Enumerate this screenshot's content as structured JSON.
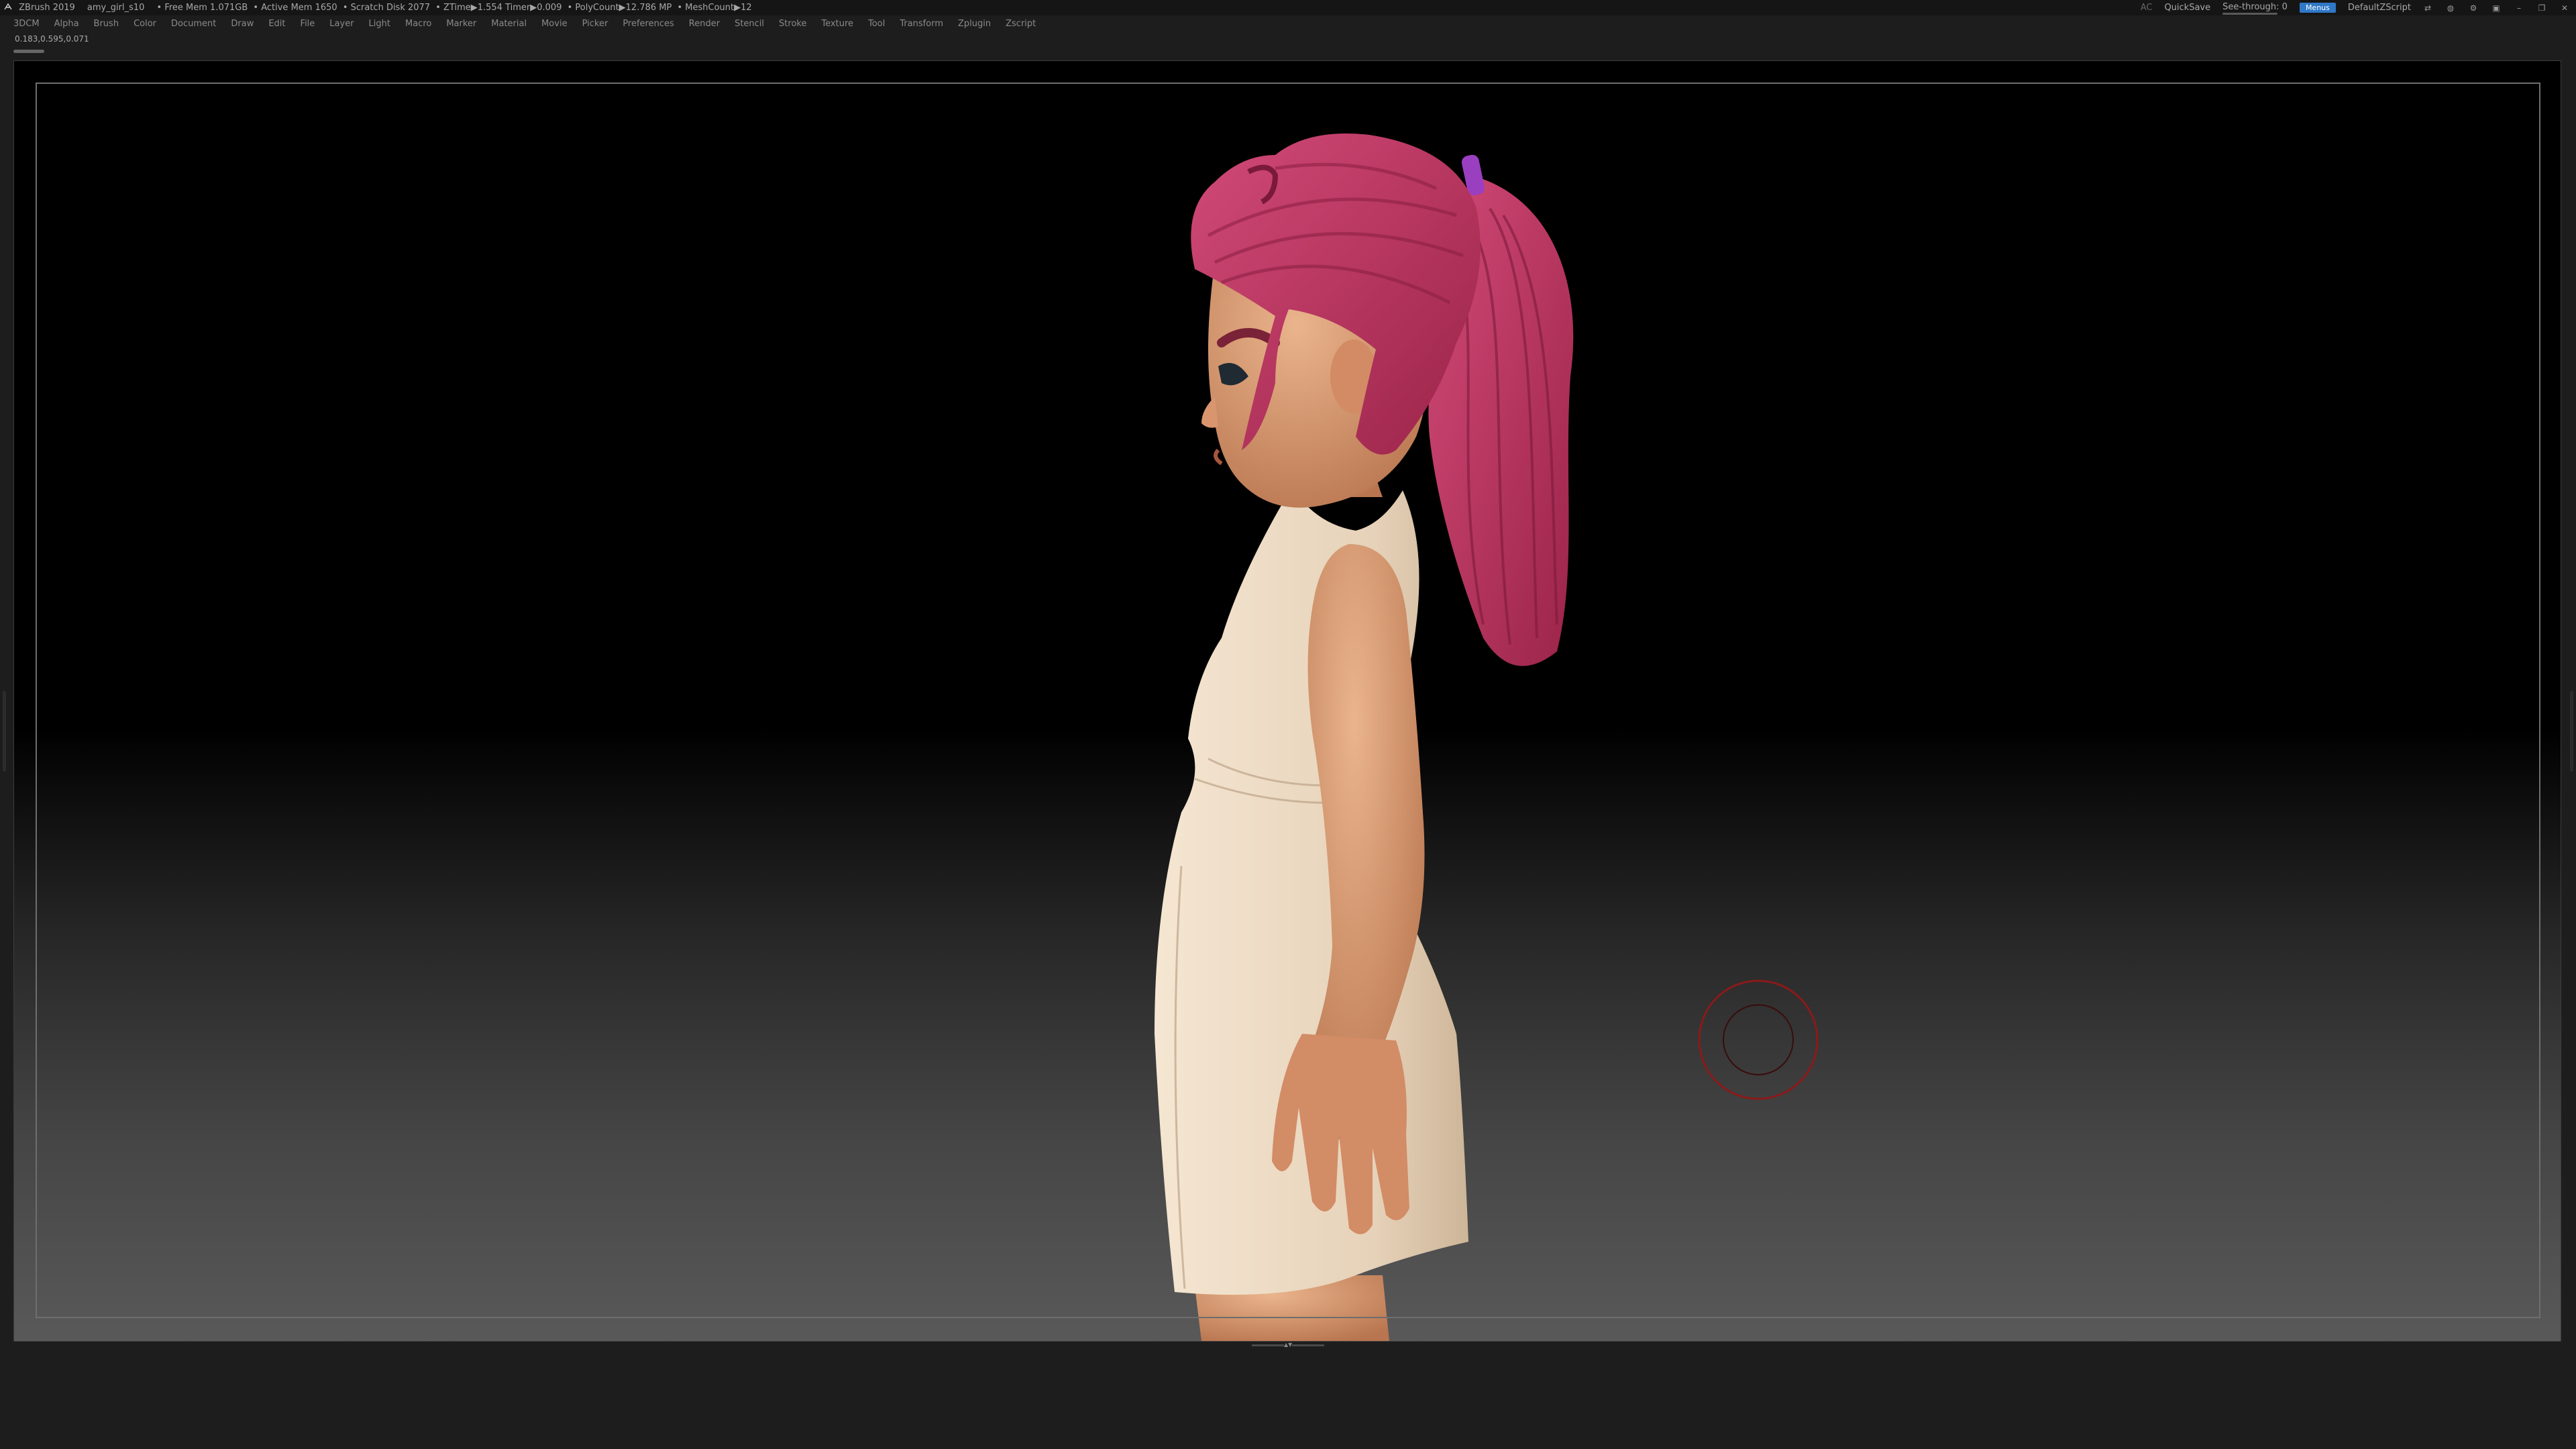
{
  "title_bar": {
    "app_name": "ZBrush 2019",
    "project_name": "amy_girl_s10",
    "stats": [
      "• Free Mem 1.071GB",
      "• Active Mem 1650",
      "• Scratch Disk 2077",
      "• ZTime▶1.554 Timer▶0.009",
      "• PolyCount▶12.786 MP",
      "• MeshCount▶12"
    ],
    "ac_label": "AC",
    "quicksave_label": "QuickSave",
    "see_through_label": "See-through",
    "see_through_value": "0",
    "see_through_level": 0.0,
    "menus_label": "Menus",
    "default_zscript_label": "DefaultZScript"
  },
  "menu_bar": {
    "items": [
      "3DCM",
      "Alpha",
      "Brush",
      "Color",
      "Document",
      "Draw",
      "Edit",
      "File",
      "Layer",
      "Light",
      "Macro",
      "Marker",
      "Material",
      "Movie",
      "Picker",
      "Preferences",
      "Render",
      "Stencil",
      "Stroke",
      "Texture",
      "Tool",
      "Transform",
      "Zplugin",
      "Zscript"
    ]
  },
  "coords_readout": "0.183,0.595,0.071",
  "colors": {
    "accent": "#2f78c8",
    "hair": "#b0305a",
    "dress": "#ecd9c2",
    "skin": "#d99870",
    "hair_tie": "#9a3fc0",
    "brush_cursor": "#8a1a1a",
    "see_through_fill": "#3f9a2f"
  },
  "icons": [
    "zbrush-logo-icon",
    "camera-icon",
    "tools-icon",
    "lock-icon",
    "minimize-icon",
    "restore-icon",
    "close-icon"
  ]
}
